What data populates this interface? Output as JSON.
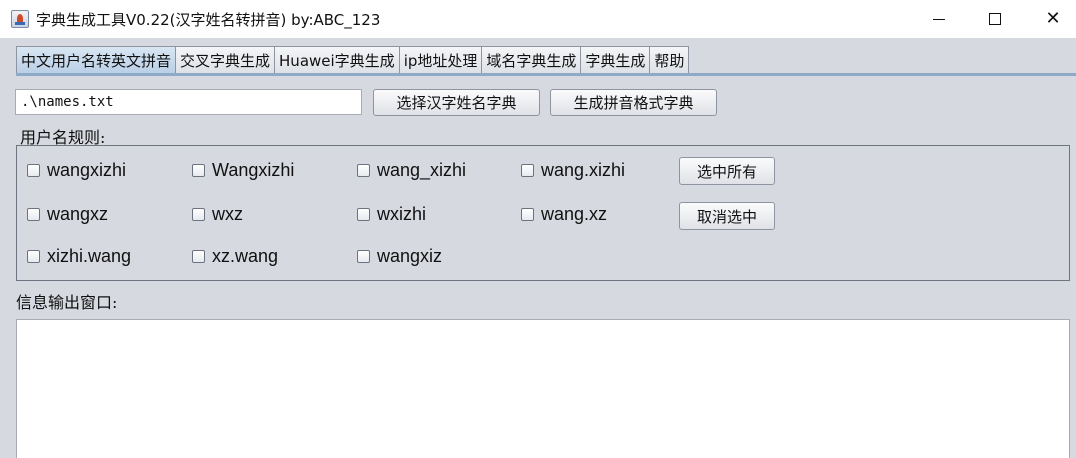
{
  "window": {
    "title": "字典生成工具V0.22(汉字姓名转拼音) by:ABC_123",
    "minimize": "—",
    "maximize": "☐",
    "close": "✕"
  },
  "tabs": [
    {
      "label": "中文用户名转英文拼音",
      "active": true
    },
    {
      "label": "交叉字典生成",
      "active": false
    },
    {
      "label": "Huawei字典生成",
      "active": false
    },
    {
      "label": "ip地址处理",
      "active": false
    },
    {
      "label": "域名字典生成",
      "active": false
    },
    {
      "label": "字典生成",
      "active": false
    },
    {
      "label": "帮助",
      "active": false
    }
  ],
  "path_input": {
    "value": ".\\names.txt"
  },
  "buttons": {
    "choose_dict": "选择汉字姓名字典",
    "generate_dict": "生成拼音格式字典",
    "select_all": "选中所有",
    "deselect": "取消选中"
  },
  "rules": {
    "label": "用户名规则:",
    "options": [
      {
        "label": "wangxizhi",
        "checked": false
      },
      {
        "label": "Wangxizhi",
        "checked": false
      },
      {
        "label": "wang_xizhi",
        "checked": false
      },
      {
        "label": "wang.xizhi",
        "checked": false
      },
      {
        "label": "wangxz",
        "checked": false
      },
      {
        "label": "wxz",
        "checked": false
      },
      {
        "label": "wxizhi",
        "checked": false
      },
      {
        "label": "wang.xz",
        "checked": false
      },
      {
        "label": "xizhi.wang",
        "checked": false
      },
      {
        "label": "xz.wang",
        "checked": false
      },
      {
        "label": "wangxiz",
        "checked": false
      }
    ]
  },
  "output": {
    "label": "信息输出窗口:",
    "text": ""
  }
}
